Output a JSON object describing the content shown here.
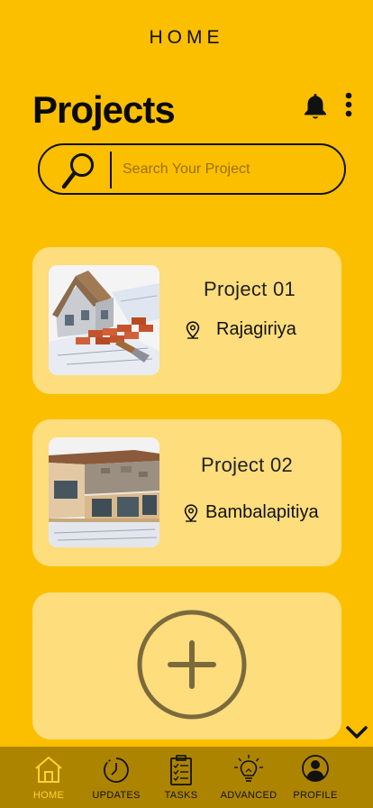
{
  "header": {
    "title": "HOME"
  },
  "page": {
    "heading": "Projects"
  },
  "search": {
    "placeholder": "Search Your Project"
  },
  "projects": [
    {
      "title": "Project 01",
      "location": "Rajagiriya"
    },
    {
      "title": "Project 02",
      "location": "Bambalapitiya"
    }
  ],
  "nav": [
    {
      "label": "HOME",
      "active": true
    },
    {
      "label": "UPDATES"
    },
    {
      "label": "TASKS"
    },
    {
      "label": "ADVANCED"
    },
    {
      "label": "PROFILE"
    }
  ],
  "colors": {
    "background": "#FBBF00",
    "card": "#FDDD7C",
    "nav": "#AD8400",
    "active": "#FFD233"
  },
  "icons": {
    "bell": "bell-icon",
    "more": "more-vertical-icon",
    "search": "search-icon",
    "pin": "location-pin-icon",
    "add": "add-circle-icon",
    "chevron": "chevron-down-icon",
    "home": "home-icon",
    "updates": "clock-icon",
    "tasks": "clipboard-icon",
    "advanced": "lightbulb-icon",
    "profile": "user-icon"
  }
}
